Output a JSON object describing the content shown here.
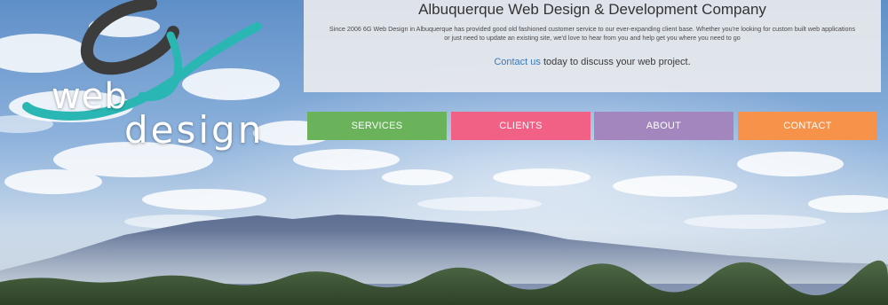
{
  "logo": {
    "word1": "web",
    "word2": "design",
    "mark": "6g-swirl-logo"
  },
  "info": {
    "title": "Albuquerque Web Design & Development Company",
    "description": "Since 2006 6G Web Design in Albuquerque has provided good old fashioned customer service to our ever-expanding client base. Whether you're looking for custom built web applications or just need to update an existing site, we'd love to hear from you and help get you where you need to go",
    "cta_link": "Contact us",
    "cta_rest": "today to discuss your web project."
  },
  "nav": {
    "items": [
      {
        "label": "SERVICES",
        "color": "#6ab35a"
      },
      {
        "label": "CLIENTS",
        "color": "#f06185"
      },
      {
        "label": "ABOUT",
        "color": "#a486be"
      },
      {
        "label": "CONTACT",
        "color": "#f7924a"
      }
    ]
  },
  "colors": {
    "sky": "#7fa6d4",
    "logo_teal": "#2ab7b4",
    "logo_dark": "#3c3c3c",
    "link": "#3b7bbf"
  }
}
